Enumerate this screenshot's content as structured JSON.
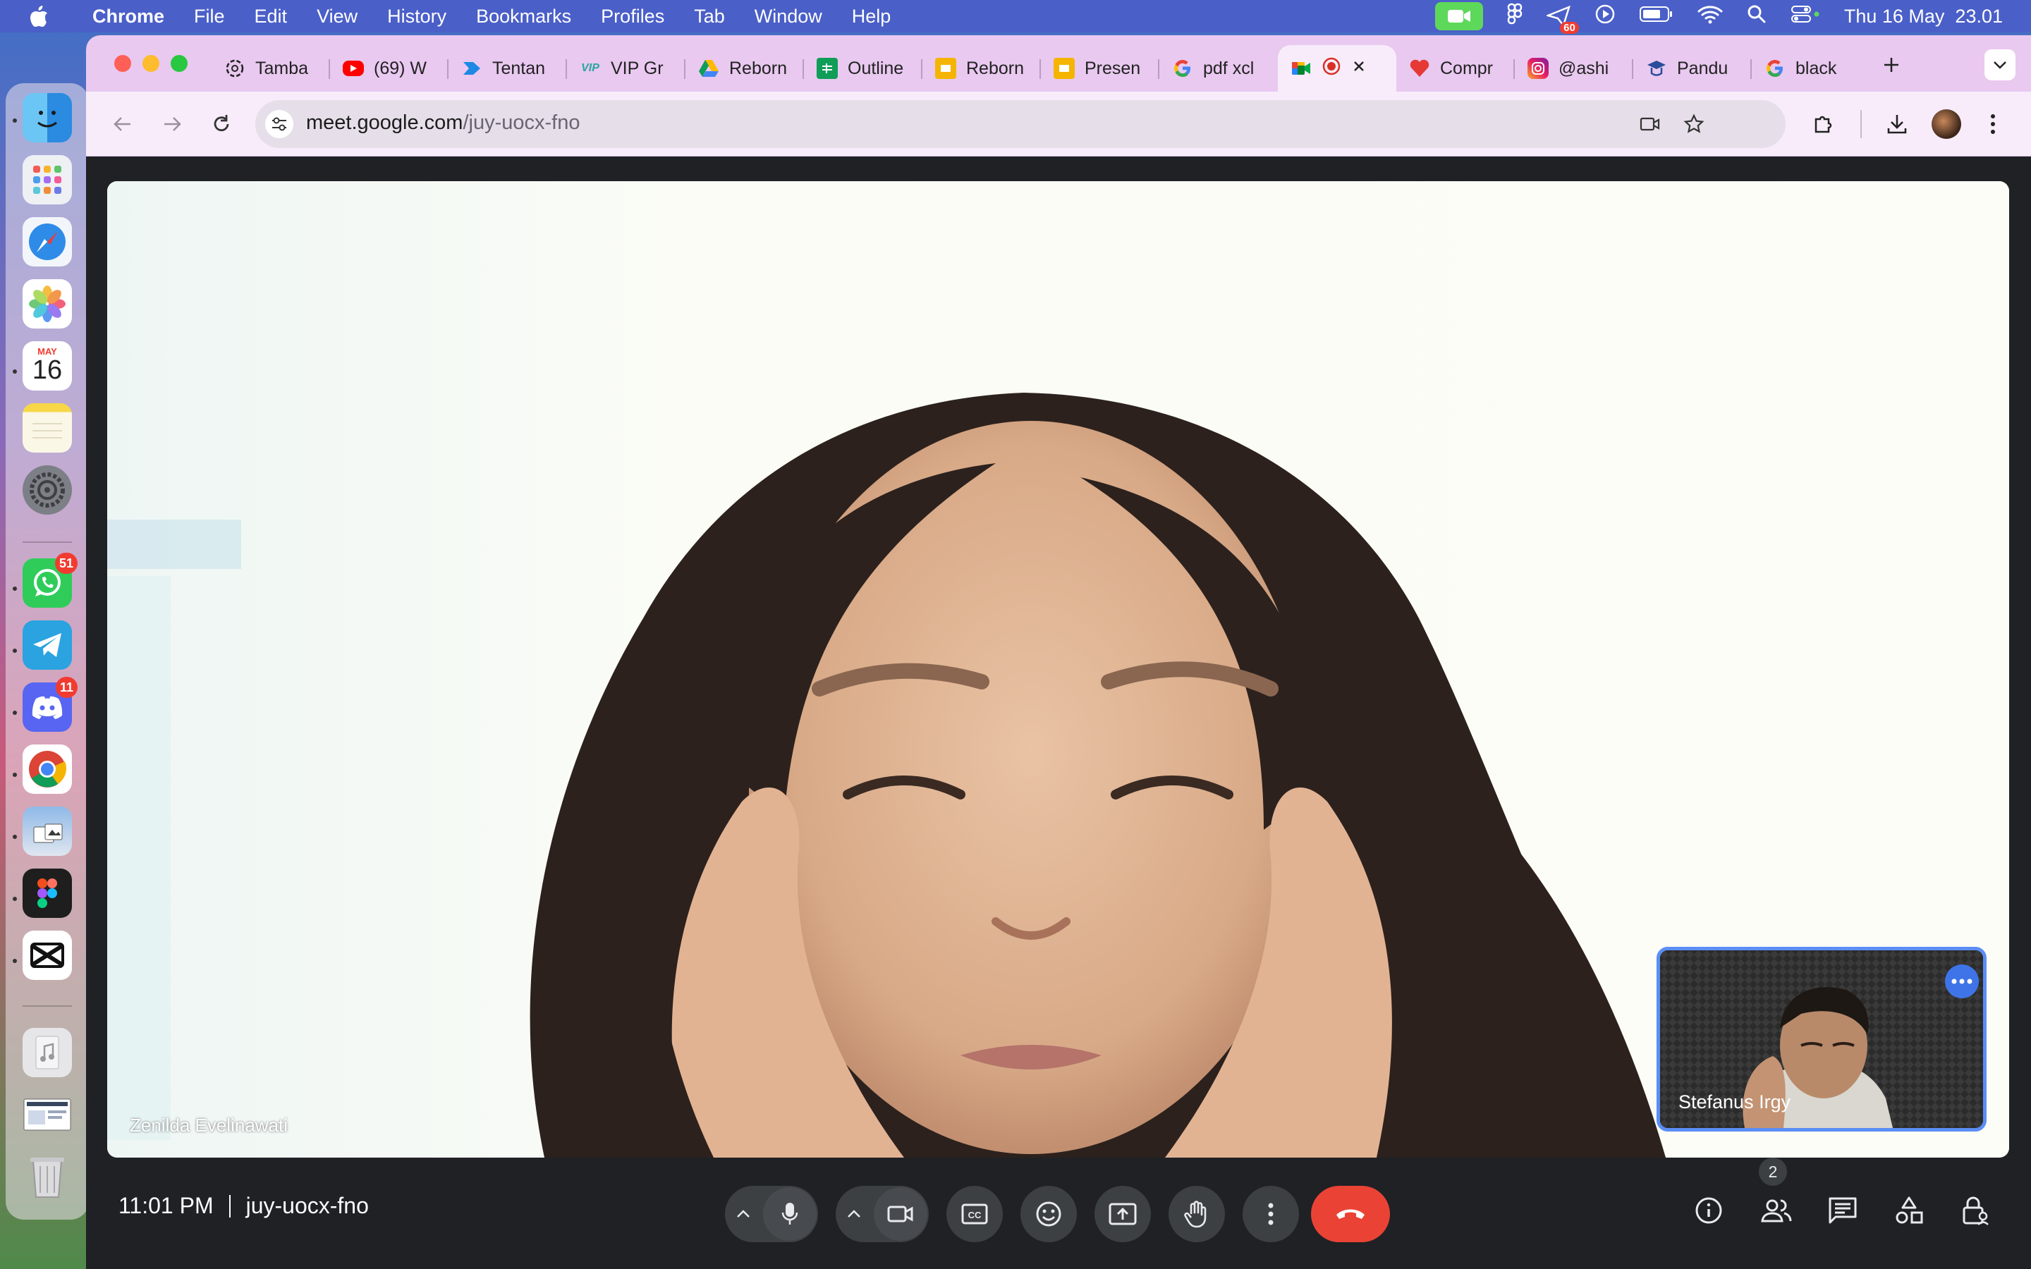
{
  "menubar": {
    "app_name": "Chrome",
    "items": [
      "File",
      "Edit",
      "View",
      "History",
      "Bookmarks",
      "Profiles",
      "Tab",
      "Window",
      "Help"
    ],
    "clock": "Thu 16 May  23.01",
    "notification_badge": "60"
  },
  "dock": {
    "calendar_month": "MAY",
    "calendar_day": "16",
    "whatsapp_badge": "51",
    "discord_badge": "11"
  },
  "tabs": [
    {
      "label": "Tamba",
      "icon": "openai-icon"
    },
    {
      "label": "(69) W",
      "icon": "youtube-icon"
    },
    {
      "label": "Tentan",
      "icon": "arrow-app-icon"
    },
    {
      "label": "VIP Gr",
      "icon": "vip-icon"
    },
    {
      "label": "Reborn",
      "icon": "drive-icon"
    },
    {
      "label": "Outline",
      "icon": "sheets-icon"
    },
    {
      "label": "Reborn",
      "icon": "slides-icon"
    },
    {
      "label": "Presen",
      "icon": "slides-icon"
    },
    {
      "label": "pdf xcl",
      "icon": "google-icon"
    },
    {
      "label": "",
      "icon": "meet-icon",
      "active": true
    },
    {
      "label": "Compr",
      "icon": "heart-icon"
    },
    {
      "label": "@ashi",
      "icon": "instagram-icon"
    },
    {
      "label": "Pandu",
      "icon": "grad-cap-icon"
    },
    {
      "label": "black",
      "icon": "google-icon"
    }
  ],
  "address": {
    "host": "meet.google.com",
    "path": "/juy-uocx-fno"
  },
  "meeting": {
    "main_participant": "Zenilda Evelinawati",
    "pip_participant": "Stefanus Irgy",
    "time": "11:01 PM",
    "code": "juy-uocx-fno",
    "participant_count": "2"
  },
  "colors": {
    "menubar": "#4a5fc8",
    "tabstrip": "#e9c9f0",
    "toolbar": "#f8ecfb",
    "meet_bg": "#1f2125",
    "end_call": "#ea4335",
    "pip_border": "#5b8df5"
  }
}
